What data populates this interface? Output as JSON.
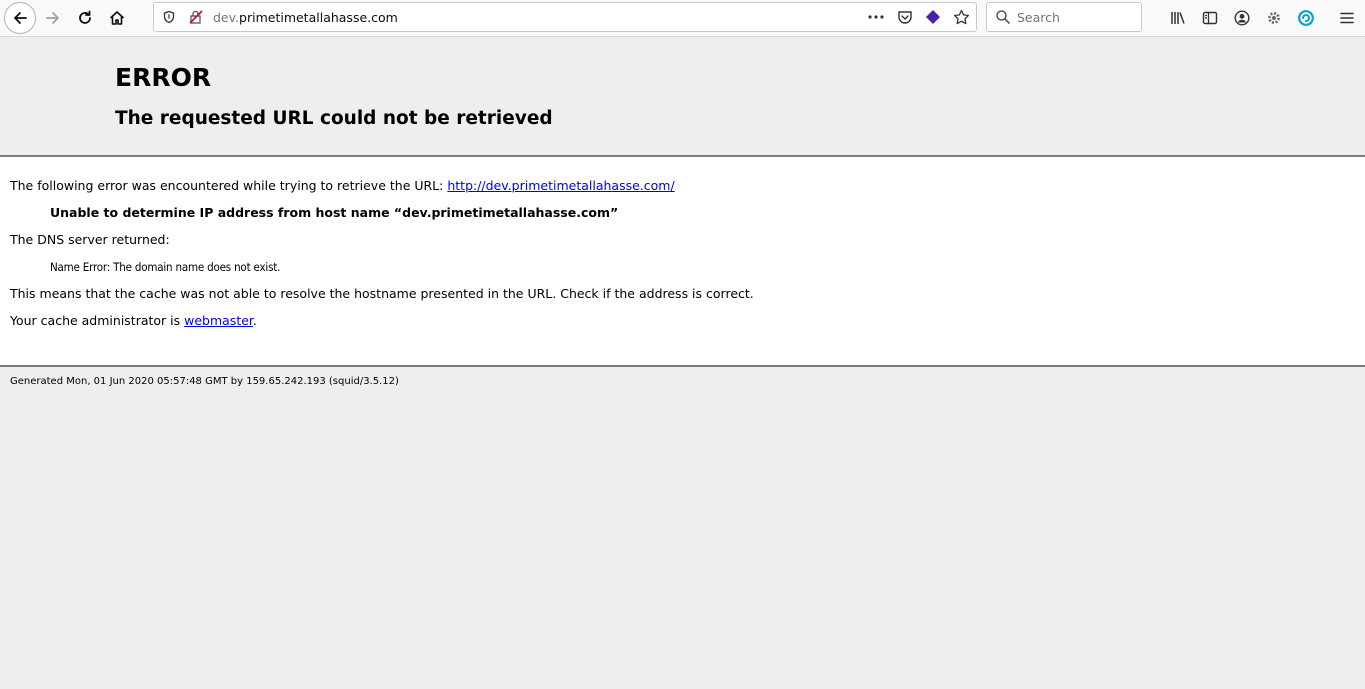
{
  "browser": {
    "url_prefix": "dev.",
    "url_domain": "primetimetallahasse.com",
    "search_placeholder": "Search",
    "icons": [
      "back-icon",
      "forward-icon",
      "reload-icon",
      "home-icon",
      "site-info-icon",
      "tracking-protection-icon",
      "page-actions-icon",
      "pocket-icon",
      "extension-icon",
      "bookmark-star-icon",
      "search-icon",
      "library-icon",
      "sidebar-icon",
      "account-icon",
      "settings-gear-icon",
      "sync-extension-icon",
      "menu-icon"
    ],
    "extension_color": "#4b1fa8"
  },
  "page": {
    "title": "ERROR",
    "subtitle": "The requested URL could not be retrieved",
    "intro_text": "The following error was encountered while trying to retrieve the URL: ",
    "intro_link": "http://dev.primetimetallahasse.com/",
    "error_detail": "Unable to determine IP address from host name “dev.primetimetallahasse.com”",
    "dns_label": "The DNS server returned:",
    "dns_message": "Name Error: The domain name does not exist.",
    "explanation": "This means that the cache was not able to resolve the hostname presented in the URL. Check if the address is correct.",
    "admin_prefix": "Your cache administrator is ",
    "admin_link": "webmaster",
    "admin_suffix": ".",
    "footer": "Generated Mon, 01 Jun 2020 05:57:48 GMT by 159.65.242.193 (squid/3.5.12)"
  }
}
